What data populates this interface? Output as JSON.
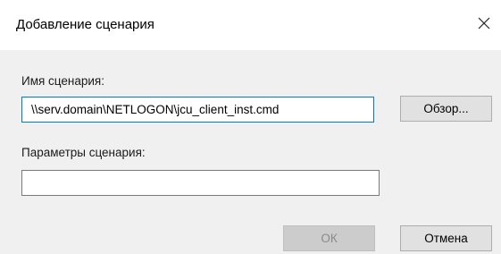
{
  "dialog": {
    "title": "Добавление сценария",
    "close_icon": "close-icon"
  },
  "script_name": {
    "label": "Имя сценария:",
    "value": "\\\\serv.domain\\NETLOGON\\jcu_client_inst.cmd",
    "browse_label": "Обзор..."
  },
  "script_params": {
    "label": "Параметры сценария:",
    "value": ""
  },
  "buttons": {
    "ok_label": "ОК",
    "cancel_label": "Отмена"
  },
  "colors": {
    "focus_border": "#0078d7",
    "dialog_background": "#f0f0f0"
  }
}
